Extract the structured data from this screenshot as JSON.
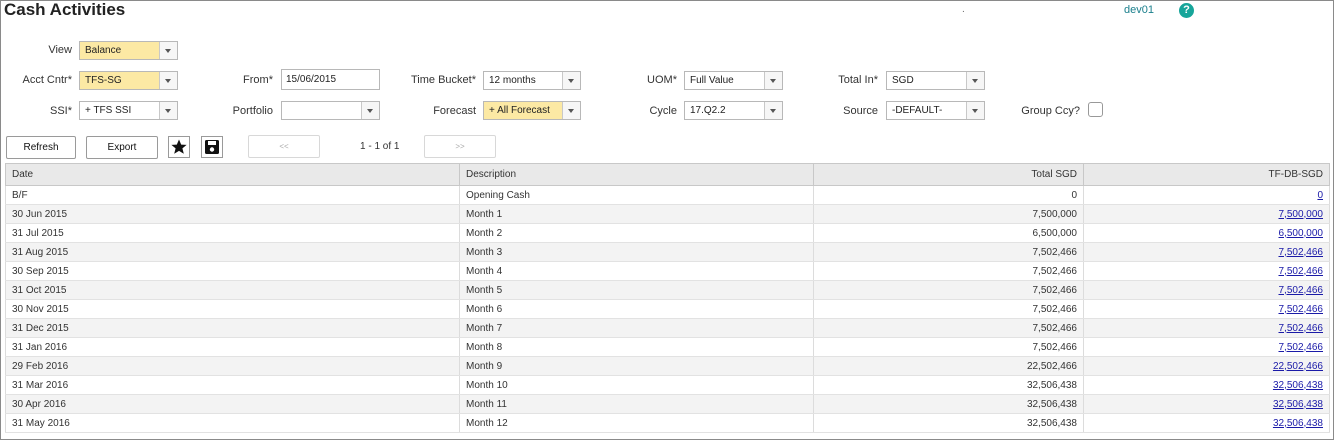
{
  "header": {
    "title": "Cash Activities",
    "dot": ".",
    "user": "dev01",
    "help_label": "?"
  },
  "filters": {
    "view": {
      "label": "View",
      "value": "Balance"
    },
    "acct_cntr": {
      "label": "Acct Cntr*",
      "value": "TFS-SG"
    },
    "ssi": {
      "label": "SSI*",
      "value": "+ TFS SSI"
    },
    "from": {
      "label": "From*",
      "value": "15/06/2015"
    },
    "portfolio": {
      "label": "Portfolio",
      "value": ""
    },
    "time_bucket": {
      "label": "Time Bucket*",
      "value": "12 months"
    },
    "forecast": {
      "label": "Forecast",
      "value": "+ All Forecast"
    },
    "uom": {
      "label": "UOM*",
      "value": "Full Value"
    },
    "cycle": {
      "label": "Cycle",
      "value": "17.Q2.2"
    },
    "total_in": {
      "label": "Total In*",
      "value": "SGD"
    },
    "source": {
      "label": "Source",
      "value": "-DEFAULT-"
    },
    "group_ccy": {
      "label": "Group Ccy?",
      "checked": false
    }
  },
  "toolbar": {
    "refresh_label": "Refresh",
    "export_label": "Export",
    "favorite_icon": "star-icon",
    "save_icon": "floppy-disk-icon",
    "prev_label": "<<",
    "next_label": ">>",
    "page_info": "1 - 1 of 1"
  },
  "table": {
    "headers": [
      "Date",
      "Description",
      "Total SGD",
      "TF-DB-SGD"
    ],
    "rows": [
      [
        "B/F",
        "Opening Cash",
        "0",
        "0"
      ],
      [
        "30 Jun 2015",
        "Month 1",
        "7,500,000",
        "7,500,000"
      ],
      [
        "31 Jul 2015",
        "Month 2",
        "6,500,000",
        "6,500,000"
      ],
      [
        "31 Aug 2015",
        "Month 3",
        "7,502,466",
        "7,502,466"
      ],
      [
        "30 Sep 2015",
        "Month 4",
        "7,502,466",
        "7,502,466"
      ],
      [
        "31 Oct 2015",
        "Month 5",
        "7,502,466",
        "7,502,466"
      ],
      [
        "30 Nov 2015",
        "Month 6",
        "7,502,466",
        "7,502,466"
      ],
      [
        "31 Dec 2015",
        "Month 7",
        "7,502,466",
        "7,502,466"
      ],
      [
        "31 Jan 2016",
        "Month 8",
        "7,502,466",
        "7,502,466"
      ],
      [
        "29 Feb 2016",
        "Month 9",
        "22,502,466",
        "22,502,466"
      ],
      [
        "31 Mar 2016",
        "Month 10",
        "32,506,438",
        "32,506,438"
      ],
      [
        "30 Apr 2016",
        "Month 11",
        "32,506,438",
        "32,506,438"
      ],
      [
        "31 May 2016",
        "Month 12",
        "32,506,438",
        "32,506,438"
      ]
    ]
  },
  "colors": {
    "highlight_field": "#fce9a4",
    "link": "#1a1aa8",
    "help": "#17a59a",
    "user": "#1a7f8c"
  }
}
